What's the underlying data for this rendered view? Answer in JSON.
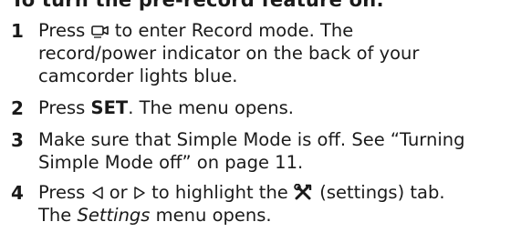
{
  "heading": "To turn the pre-record feature on:",
  "steps": [
    {
      "number": "1",
      "before_icon": "Press",
      "icon": "record-mode-icon",
      "line1_rest": "to enter Record mode. The",
      "line2": "record/power indicator on the back of your",
      "line3": "camcorder lights blue."
    },
    {
      "number": "2",
      "before_bold": "Press",
      "bold": "SET",
      "after_bold": ". The menu opens."
    },
    {
      "number": "3",
      "line1": "Make sure that Simple Mode is off. See “Turning",
      "line2": "Simple Mode off” on page 11."
    },
    {
      "number": "4",
      "before_left": "Press",
      "left_icon": "left-triangle-icon",
      "or_text": "or",
      "right_icon": "right-triangle-icon",
      "highlight_text": "to highlight the",
      "settings_icon": "settings-tools-icon",
      "after_settings": "(settings) tab.",
      "line2_before": "The",
      "line2_italic": "Settings",
      "line2_after": "menu opens."
    }
  ]
}
